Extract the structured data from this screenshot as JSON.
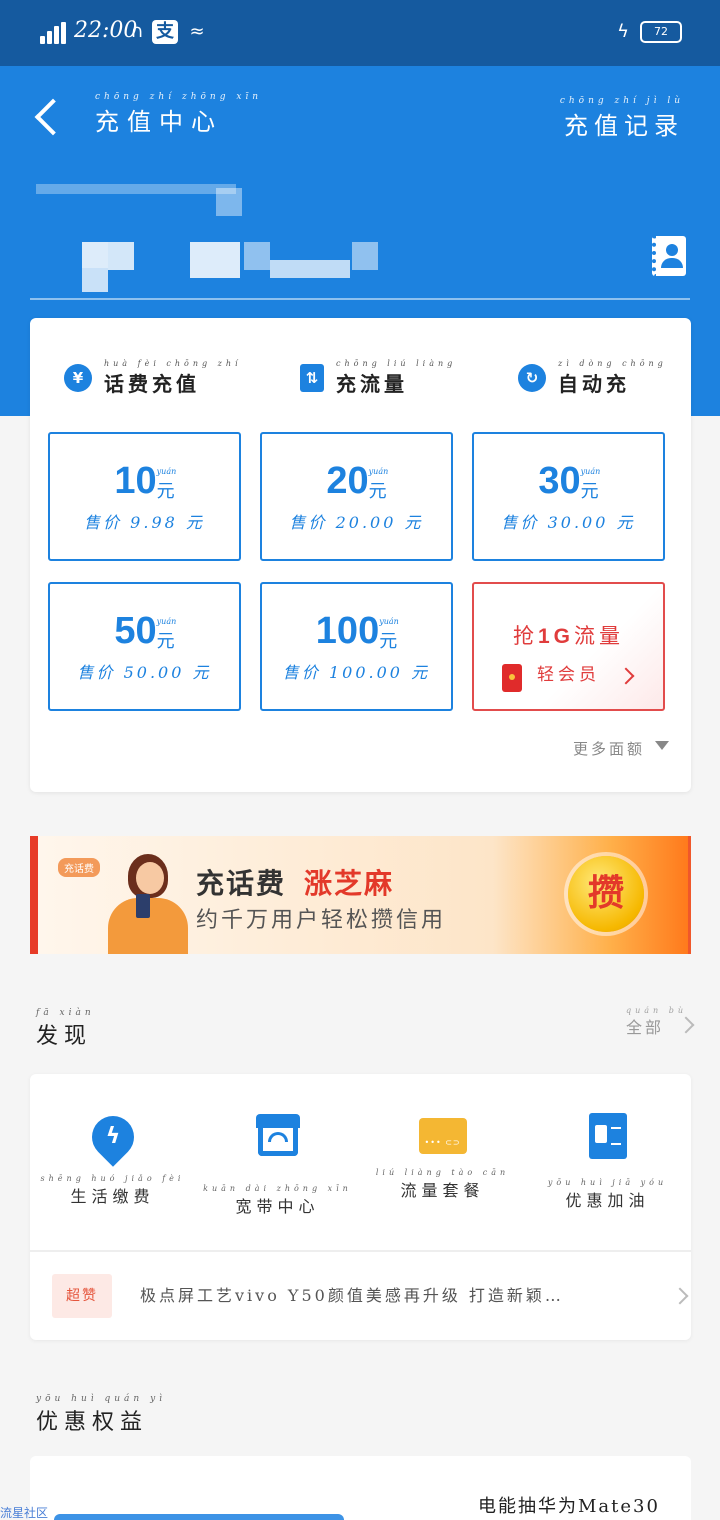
{
  "status_bar": {
    "time": "22:00",
    "battery": "72",
    "app_icon": "支"
  },
  "header": {
    "title": "充值中心",
    "title_pinyin": "chōng zhí zhōng xīn",
    "records": "充值记录",
    "records_pinyin": "chōng zhí jì lù"
  },
  "tabs": [
    {
      "icon": "yen-search-icon",
      "glyph": "¥",
      "label": "话费充值",
      "pinyin": "huà fèi chōng zhí"
    },
    {
      "icon": "data-transfer-icon",
      "glyph": "⇅",
      "label": "充流量",
      "pinyin": "chōng liú liàng"
    },
    {
      "icon": "auto-refresh-icon",
      "glyph": "↻",
      "label": "自动充",
      "pinyin": "zì dòng chōng"
    }
  ],
  "amounts": [
    {
      "value": "10",
      "unit": "元",
      "unit_pinyin": "yuán",
      "price": "售价 9.98 元"
    },
    {
      "value": "20",
      "unit": "元",
      "unit_pinyin": "yuán",
      "price": "售价 20.00 元"
    },
    {
      "value": "30",
      "unit": "元",
      "unit_pinyin": "yuán",
      "price": "售价 30.00 元"
    },
    {
      "value": "50",
      "unit": "元",
      "unit_pinyin": "yuán",
      "price": "售价 50.00 元"
    },
    {
      "value": "100",
      "unit": "元",
      "unit_pinyin": "yuán",
      "price": "售价 100.00 元"
    }
  ],
  "promo": {
    "title_pre": "抢",
    "title_bold": "1G",
    "title_post": "流量",
    "subtitle": "轻会员",
    "color": "#e03c3c"
  },
  "more": "更多面额",
  "banner": {
    "tag": "充话费",
    "line1": "充话费",
    "line1_highlight": "涨芝麻",
    "line2": "约千万用户轻松攒信用",
    "coin": "攒"
  },
  "discover": {
    "title": "发现",
    "title_pinyin": "fā xiàn",
    "all": "全部",
    "all_pinyin": "quán bù",
    "services": [
      {
        "icon": "lightning-drop-icon",
        "label": "生活缴费",
        "pinyin": "shēng huó jiǎo fèi"
      },
      {
        "icon": "store-wifi-icon",
        "label": "宽带中心",
        "pinyin": "kuān dài zhōng xīn"
      },
      {
        "icon": "data-card-icon",
        "label": "流量套餐",
        "pinyin": "liú liàng tào cān"
      },
      {
        "icon": "fuel-pump-icon",
        "label": "优惠加油",
        "pinyin": "yōu huì jiā yóu"
      }
    ],
    "news_tag": "超赞",
    "news_text": "极点屏工艺vivo Y50颜值美感再升级 打造新颖…"
  },
  "benefits": {
    "title": "优惠权益",
    "title_pinyin": "yōu huì quán yì",
    "item_text": "电能抽华为Mate30"
  },
  "watermark": "流星社区",
  "colors": {
    "primary": "#1d82df",
    "statusbar": "#155a9f",
    "accent_red": "#e3392a"
  }
}
